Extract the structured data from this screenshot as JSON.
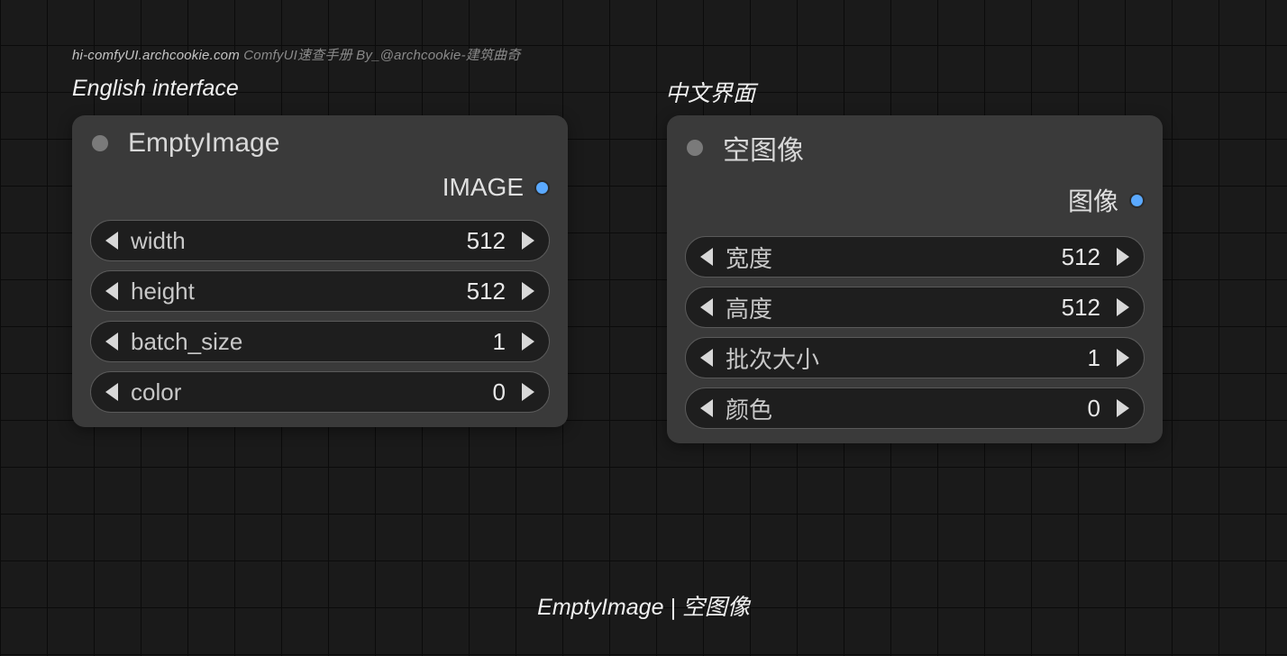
{
  "watermark": {
    "domain": "hi-comfyUI.archcookie.com",
    "rest": " ComfyUI速查手册 By_@archcookie-建筑曲奇"
  },
  "labels": {
    "english": "English interface",
    "chinese": "中文界面"
  },
  "nodes": {
    "en": {
      "title": "EmptyImage",
      "output": "IMAGE",
      "widgets": [
        {
          "label": "width",
          "value": "512"
        },
        {
          "label": "height",
          "value": "512"
        },
        {
          "label": "batch_size",
          "value": "1"
        },
        {
          "label": "color",
          "value": "0"
        }
      ]
    },
    "zh": {
      "title": "空图像",
      "output": "图像",
      "widgets": [
        {
          "label": "宽度",
          "value": "512"
        },
        {
          "label": "高度",
          "value": "512"
        },
        {
          "label": "批次大小",
          "value": "1"
        },
        {
          "label": "颜色",
          "value": "0"
        }
      ]
    }
  },
  "caption": "EmptyImage | 空图像"
}
